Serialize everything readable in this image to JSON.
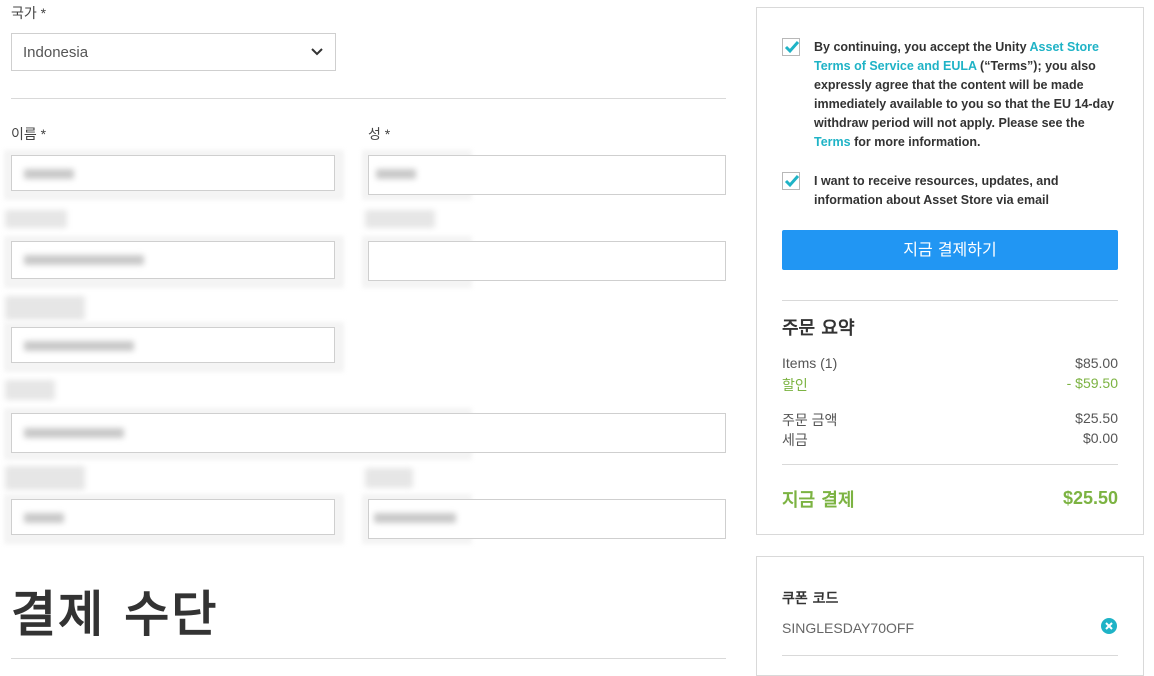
{
  "form": {
    "country_label": "국가 *",
    "country_value": "Indonesia",
    "first_name_label": "이름 *",
    "last_name_label": "성 *"
  },
  "payment": {
    "heading": "결제 수단"
  },
  "consent": {
    "terms_prefix": "By continuing, you accept the Unity ",
    "terms_link": "Asset Store Terms of Service and EULA",
    "terms_mid": " (“Terms”); you also expressly agree that the content will be made immediately available to you so that the EU 14-day withdraw period will not apply. Please see the ",
    "terms_link2": "Terms",
    "terms_suffix": " for more information.",
    "newsletter": "I want to receive resources, updates, and information about Asset Store via email",
    "terms_checked": true,
    "newsletter_checked": true
  },
  "checkout": {
    "pay_now_label": "지금 결제하기"
  },
  "summary": {
    "title": "주문 요약",
    "items_label": "Items (1)",
    "items_value": "$85.00",
    "discount_label": "할인",
    "discount_value": "- $59.50",
    "subtotal_label": "주문 금액",
    "subtotal_value": "$25.50",
    "tax_label": "세금",
    "tax_value": "$0.00",
    "total_label": "지금 결제",
    "total_value": "$25.50"
  },
  "coupon": {
    "title": "쿠폰 코드",
    "code": "SINGLESDAY70OFF"
  },
  "colors": {
    "accent_blue": "#2196f3",
    "link_teal": "#1fb3c6",
    "discount_green": "#7cb342"
  }
}
